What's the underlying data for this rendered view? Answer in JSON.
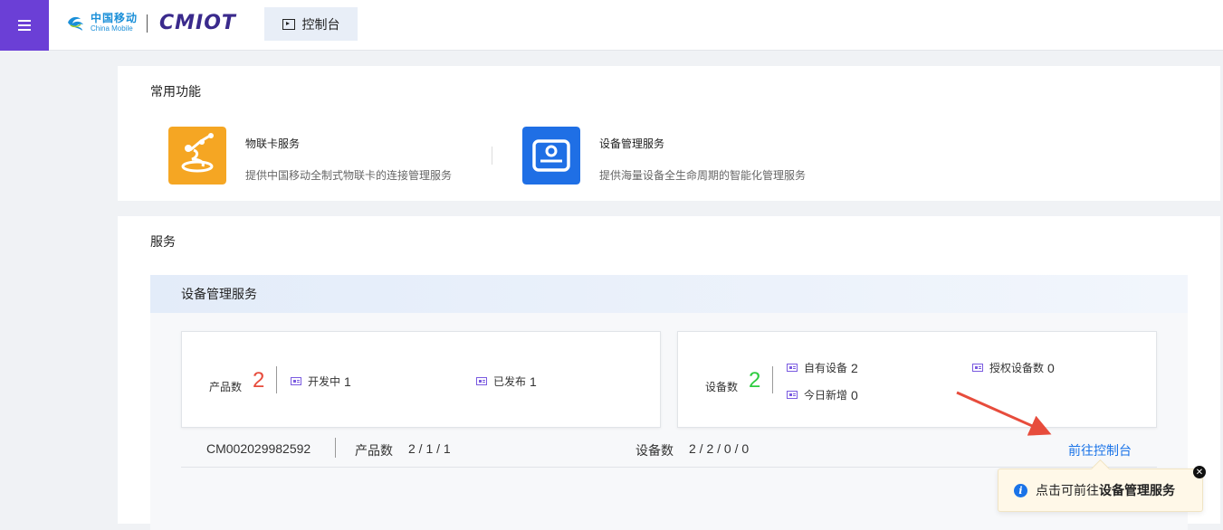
{
  "header": {
    "logo_cn": "中国移动",
    "logo_en": "China Mobile",
    "logo_product": "CMIOT",
    "console_tab": "控制台",
    "colors": {
      "menu_bg": "#6b3fd6",
      "link": "#1a73e8"
    }
  },
  "common": {
    "title": "常用功能",
    "items": [
      {
        "name": "物联卡服务",
        "desc": "提供中国移动全制式物联卡的连接管理服务",
        "icon": "iot-card-icon",
        "color": "#f5a623"
      },
      {
        "name": "设备管理服务",
        "desc": "提供海量设备全生命周期的智能化管理服务",
        "icon": "device-management-icon",
        "color": "#1f6fe5"
      }
    ]
  },
  "services": {
    "title": "服务",
    "card_title": "设备管理服务",
    "product": {
      "label": "产品数",
      "count": "2",
      "dev_label": "开发中",
      "dev_value": "1",
      "pub_label": "已发布",
      "pub_value": "1"
    },
    "device": {
      "label": "设备数",
      "count": "2",
      "own_label": "自有设备",
      "own_value": "2",
      "auth_label": "授权设备数",
      "auth_value": "0",
      "today_label": "今日新增",
      "today_value": "0"
    },
    "instance": {
      "id": "CM002029982592",
      "product_label": "产品数",
      "product_value": "2 / 1 / 1",
      "device_label": "设备数",
      "device_value": "2 / 2 / 0 / 0",
      "link": "前往控制台"
    }
  },
  "tooltip": {
    "prefix": "点击可前往",
    "bold": "设备管理服务"
  }
}
